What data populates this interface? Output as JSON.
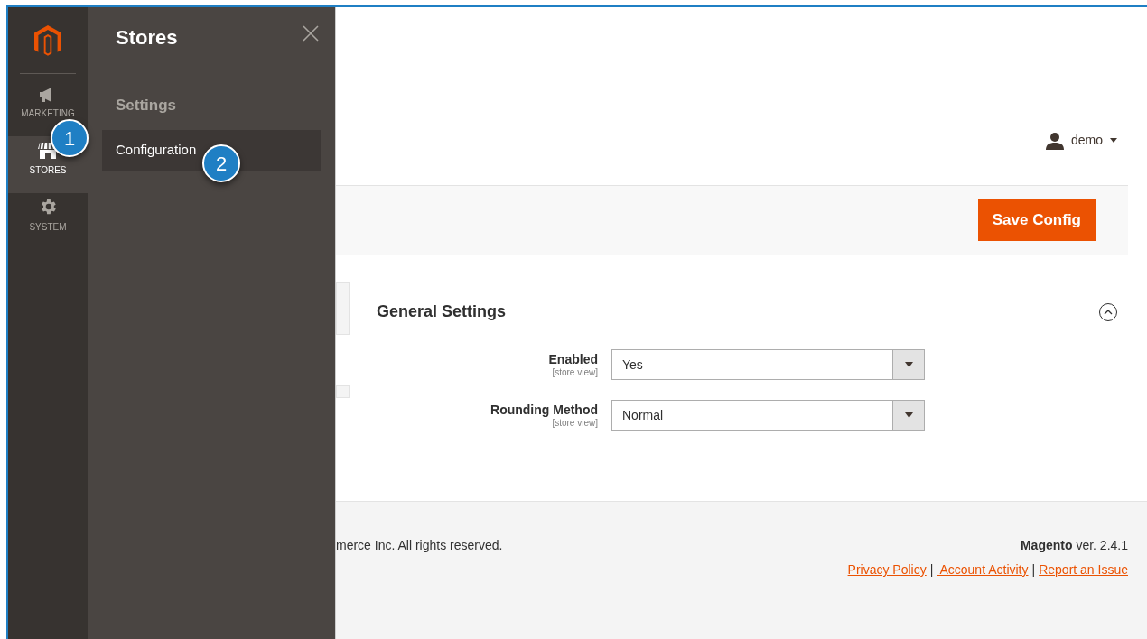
{
  "nav": {
    "items": [
      {
        "label": "MARKETING",
        "kind": "megaphone",
        "selected": false
      },
      {
        "label": "STORES",
        "kind": "store",
        "selected": true
      },
      {
        "label": "SYSTEM",
        "kind": "gear",
        "selected": false
      }
    ]
  },
  "flyout": {
    "title": "Stores",
    "section": "Settings",
    "items": [
      {
        "label": "Configuration",
        "selected": true
      }
    ]
  },
  "callouts": [
    "1",
    "2"
  ],
  "header": {
    "user": "demo"
  },
  "actions": {
    "save": "Save Config"
  },
  "section": {
    "title": "General Settings",
    "expanded": true,
    "fields": [
      {
        "label": "Enabled",
        "scope": "[store view]",
        "value": "Yes"
      },
      {
        "label": "Rounding Method",
        "scope": "[store view]",
        "value": "Normal"
      }
    ]
  },
  "footer": {
    "copyright": "merce Inc. All rights reserved.",
    "version": "**Magento** ver. 2.4.1",
    "links": [
      "Privacy Policy",
      " Account Activity",
      "Report an Issue"
    ],
    "separator": "|"
  }
}
